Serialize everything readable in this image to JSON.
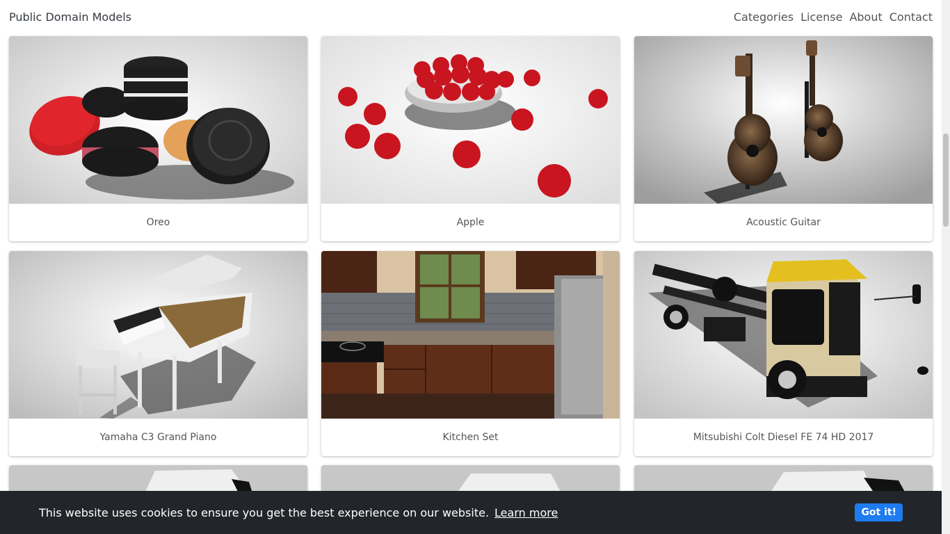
{
  "nav": {
    "brand": "Public Domain Models",
    "links": [
      "Categories",
      "License",
      "About",
      "Contact"
    ]
  },
  "models": [
    {
      "title": "Oreo"
    },
    {
      "title": "Apple"
    },
    {
      "title": "Acoustic Guitar"
    },
    {
      "title": "Yamaha C3 Grand Piano"
    },
    {
      "title": "Kitchen Set"
    },
    {
      "title": "Mitsubishi Colt Diesel FE 74 HD 2017"
    }
  ],
  "cookie": {
    "message": "This website uses cookies to ensure you get the best experience on our website.",
    "learn_more": "Learn more",
    "button": "Got it!"
  },
  "colors": {
    "cookie_bg": "#22262a",
    "accent": "#1e7bf0"
  }
}
